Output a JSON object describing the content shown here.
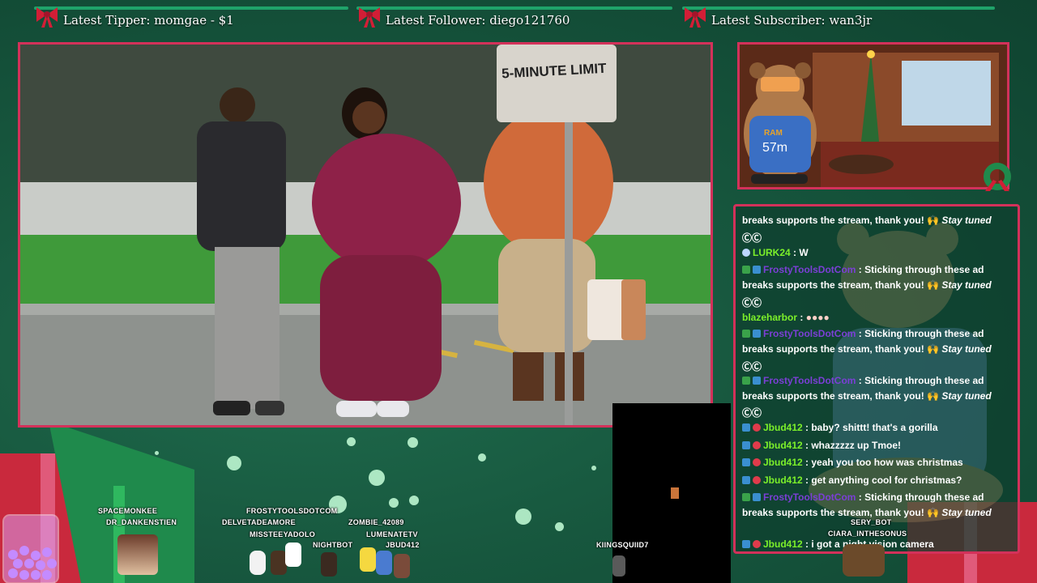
{
  "top_bars": {
    "tipper": "Latest Tipper: momgae - $1",
    "follower": "Latest Follower: diego121760",
    "subscriber": "Latest Subscriber: wan3jr"
  },
  "video": {
    "sign_text": "5-MINUTE LIMIT"
  },
  "webcam": {
    "timer": "57m",
    "shirt_text": "RAM"
  },
  "chat": {
    "messages": [
      {
        "user": "",
        "text": "breaks supports the stream, thank you! 🙌 ",
        "italic": "Stay tuned"
      },
      {
        "user": "",
        "text": "ⒸⒸ",
        "italic": ""
      },
      {
        "user": "LURK24",
        "text": " : W",
        "italic": ""
      },
      {
        "user": "FrostyToolsDotCom",
        "text": " : Sticking through these ad",
        "italic": ""
      },
      {
        "user": "",
        "text": "breaks supports the stream, thank you! 🙌 ",
        "italic": "Stay tuned"
      },
      {
        "user": "",
        "text": "ⒸⒸ",
        "italic": ""
      },
      {
        "user": "blazeharbor",
        "text": " :",
        "italic": ""
      },
      {
        "user": "FrostyToolsDotCom",
        "text": " : Sticking through these ad",
        "italic": ""
      },
      {
        "user": "",
        "text": "breaks supports the stream, thank you! 🙌 ",
        "italic": "Stay tuned"
      },
      {
        "user": "",
        "text": "ⒸⒸ",
        "italic": ""
      },
      {
        "user": "FrostyToolsDotCom",
        "text": " : Sticking through these ad",
        "italic": ""
      },
      {
        "user": "",
        "text": "breaks supports the stream, thank you! 🙌 ",
        "italic": "Stay tuned"
      },
      {
        "user": "",
        "text": "ⒸⒸ",
        "italic": ""
      },
      {
        "user": "Jbud412",
        "text": " : baby? shittt! that's a gorilla",
        "italic": ""
      },
      {
        "user": "Jbud412",
        "text": " : whazzzzz up Tmoe!",
        "italic": ""
      },
      {
        "user": "Jbud412",
        "text": " : yeah you too how was christmas",
        "italic": ""
      },
      {
        "user": "Jbud412",
        "text": " : get anything cool for christmas?",
        "italic": ""
      },
      {
        "user": "FrostyToolsDotCom",
        "text": " : Sticking through these ad",
        "italic": ""
      },
      {
        "user": "",
        "text": "breaks supports the stream, thank you! 🙌 ",
        "italic": "Stay tuned"
      },
      {
        "user": "Jbud412",
        "text": " : i got a night vision camera",
        "italic": ""
      }
    ]
  },
  "viewers": {
    "spacemonkee": "SPACEMONKEE",
    "dr_dankenstien": "DR_DANKENSTIEN",
    "frostytoolsdotcom": "FROSTYTOOLSDOTCOM",
    "delvetadeamore": "DELVETADEAMORE",
    "zombie": "ZOMBIE_42089",
    "missteeyadolo": "MISSTEEYADOLO",
    "lumenatetv": "LUMENATETV",
    "nightbot": "NIGHTBOT",
    "jbud412": "JBUD412",
    "kingsquiid7": "KIINGSQUIID7",
    "serybot": "SERY_BOT",
    "ciara": "CIARA_INTHESONUS"
  }
}
